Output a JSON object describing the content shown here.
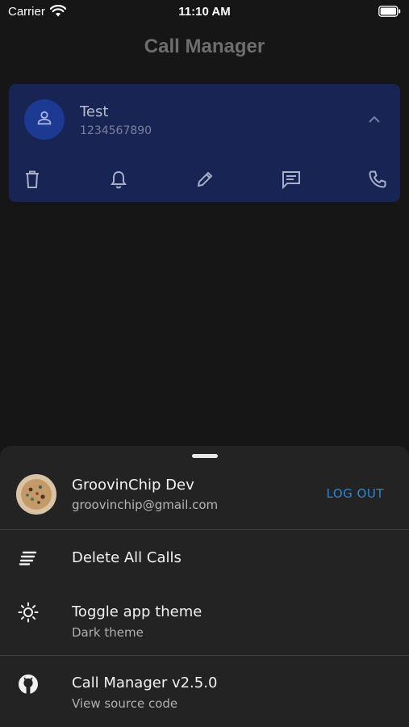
{
  "status_bar": {
    "carrier": "Carrier",
    "time": "11:10 AM"
  },
  "app": {
    "title": "Call Manager"
  },
  "call": {
    "name": "Test",
    "number": "1234567890"
  },
  "drawer": {
    "user_name": "GroovinChip Dev",
    "user_email": "groovinchip@gmail.com",
    "logout_label": "LOG OUT",
    "items": [
      {
        "title": "Delete All Calls",
        "subtitle": ""
      },
      {
        "title": "Toggle app theme",
        "subtitle": "Dark theme"
      },
      {
        "title": "Call Manager v2.5.0",
        "subtitle": "View source code"
      }
    ]
  },
  "colors": {
    "background": "#161616",
    "card": "#182454",
    "sheet": "#232323",
    "accent": "#2b88d8"
  },
  "icons": {
    "card_actions": [
      "delete-icon",
      "bell-icon",
      "edit-icon",
      "message-icon",
      "phone-icon"
    ],
    "drawer_items": [
      "sort-lines-icon",
      "sun-icon",
      "github-icon"
    ]
  }
}
